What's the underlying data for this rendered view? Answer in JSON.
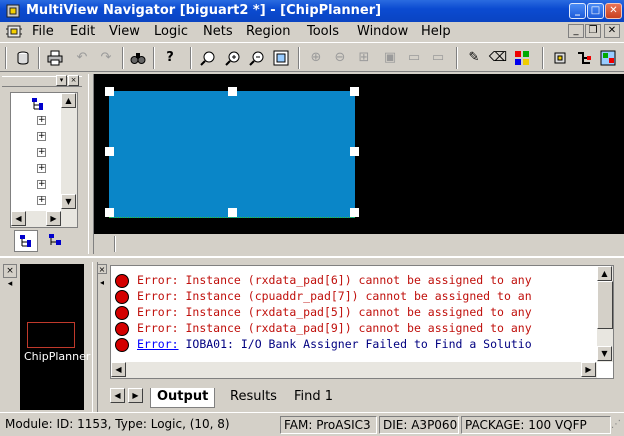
{
  "window": {
    "title": "MultiView Navigator [biguart2 *] - [ChipPlanner]",
    "controls": {
      "minimize": "_",
      "maximize": "□",
      "close": "✕"
    }
  },
  "menubar": {
    "items": [
      "File",
      "Edit",
      "View",
      "Logic",
      "Nets",
      "Region",
      "Tools",
      "Window",
      "Help"
    ],
    "mdi_controls": {
      "minimize": "_",
      "restore": "❐",
      "close": "✕"
    }
  },
  "toolbar": {
    "icons": [
      "save-icon",
      "print-icon",
      "undo-icon",
      "redo-icon",
      "find-icon",
      "help-icon",
      "zoom-fit-icon",
      "zoom-in-icon",
      "zoom-out-icon",
      "zoom-box-icon",
      "assign-icon",
      "unassign-icon",
      "lock-icon",
      "region-icon",
      "move-icon",
      "pencil-icon",
      "eraser-icon",
      "color-icon",
      "chip-icon",
      "net-icon",
      "layout-icon"
    ]
  },
  "tree": {
    "tabs": [
      "hierarchy-tab",
      "ports-tab"
    ]
  },
  "minimap": {
    "label": "ChipPlanner"
  },
  "output": {
    "messages": [
      {
        "type": "error",
        "prefix": "Error:",
        "text": " Instance (rxdata_pad[6]) cannot be assigned to any"
      },
      {
        "type": "error",
        "prefix": "Error:",
        "text": " Instance (cpuaddr_pad[7]) cannot be assigned to an"
      },
      {
        "type": "error",
        "prefix": "Error:",
        "text": " Instance (rxdata_pad[5]) cannot be assigned to any"
      },
      {
        "type": "error",
        "prefix": "Error:",
        "text": " Instance (rxdata_pad[9]) cannot be assigned to any"
      },
      {
        "type": "info",
        "prefix": "Error:",
        "text": " IOBA01: I/O Bank Assigner Failed to Find a Solutio"
      }
    ],
    "tabs": [
      "Output",
      "Results",
      "Find 1"
    ]
  },
  "status": {
    "module": "Module: ID: 1153, Type: Logic, (10, 8)",
    "family": "FAM: ProASIC3",
    "die": "DIE: A3P060",
    "package": "PACKAGE: 100 VQFP"
  },
  "colors": {
    "titlebar": "#0b4bd1",
    "block": "#0a86c8",
    "error_text": "#c0100c",
    "canvas": "#000000"
  }
}
